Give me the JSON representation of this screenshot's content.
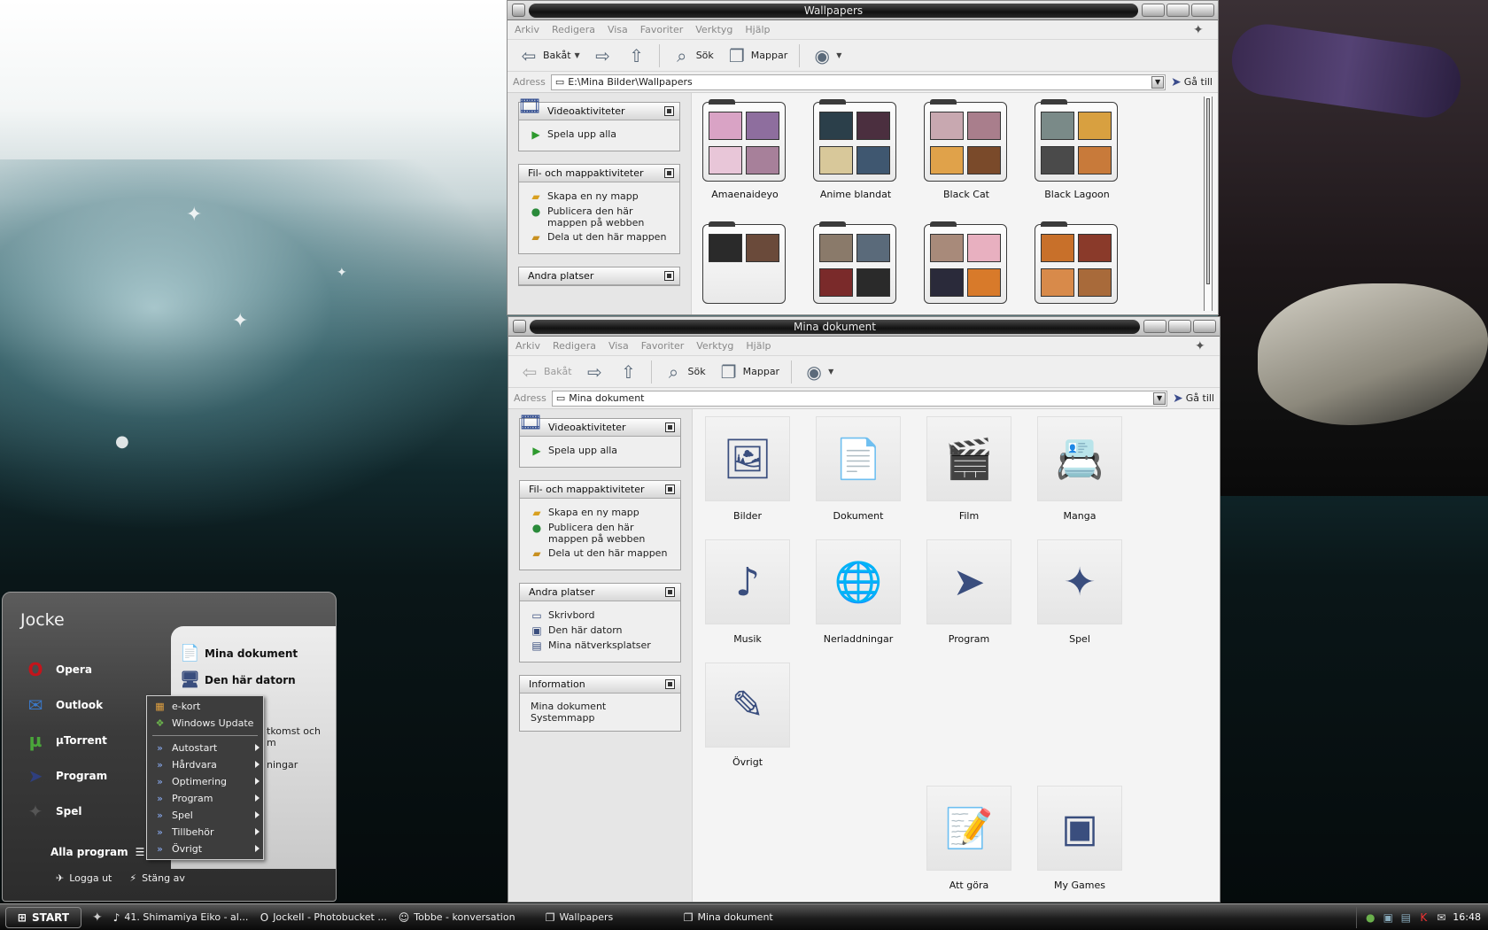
{
  "colors": {
    "accent": "#3a4e7e",
    "titlebar_dark": "#121212",
    "taskbar": "#1d1d1d",
    "startmenu": "#3b3b3b"
  },
  "window_wallpapers": {
    "title": "Wallpapers",
    "menu": [
      "Arkiv",
      "Redigera",
      "Visa",
      "Favoriter",
      "Verktyg",
      "Hjälp"
    ],
    "toolbar": {
      "back": "Bakåt",
      "search": "Sök",
      "folders": "Mappar"
    },
    "address_label": "Adress",
    "address_value": "E:\\Mina Bilder\\Wallpapers",
    "goto": "Gå till",
    "taskpane": {
      "video": {
        "title": "Videoaktiviteter",
        "items": [
          "Spela upp alla"
        ]
      },
      "file": {
        "title": "Fil- och mappaktiviteter",
        "items": [
          "Skapa en ny mapp",
          "Publicera den här mappen på webben",
          "Dela ut den här mappen"
        ]
      },
      "other": {
        "title": "Andra platser"
      }
    },
    "folders": [
      {
        "label": "Amaenaideyo",
        "colors": [
          "#d9a3c5",
          "#8e6e9e",
          "#e8c6d8",
          "#a7809a"
        ]
      },
      {
        "label": "Anime blandat",
        "colors": [
          "#2b3f4a",
          "#4b2f3f",
          "#d8c89a",
          "#3f5770"
        ]
      },
      {
        "label": "Black Cat",
        "colors": [
          "#c8a8b0",
          "#a97e8c",
          "#e0a24a",
          "#7a4a2a"
        ]
      },
      {
        "label": "Black Lagoon",
        "colors": [
          "#7a8a88",
          "#d8a040",
          "#4a4a4a",
          "#c87a3a"
        ]
      },
      {
        "label": "",
        "colors": [
          "#2a2a2a",
          "#6a4a3a"
        ]
      },
      {
        "label": "",
        "colors": [
          "#8a7a6a",
          "#5a6a7a",
          "#7a2a2a",
          "#2a2a2a"
        ]
      },
      {
        "label": "",
        "colors": [
          "#a88a7a",
          "#e8b0c0",
          "#2a2a3a",
          "#d87a2a"
        ]
      },
      {
        "label": "",
        "colors": [
          "#c8702a",
          "#8a3a2a",
          "#d88a4a",
          "#a86a3a"
        ]
      }
    ]
  },
  "window_docs": {
    "title": "Mina dokument",
    "menu": [
      "Arkiv",
      "Redigera",
      "Visa",
      "Favoriter",
      "Verktyg",
      "Hjälp"
    ],
    "toolbar": {
      "back": "Bakåt",
      "search": "Sök",
      "folders": "Mappar"
    },
    "address_label": "Adress",
    "address_value": "Mina dokument",
    "goto": "Gå till",
    "taskpane": {
      "video": {
        "title": "Videoaktiviteter",
        "items": [
          "Spela upp alla"
        ]
      },
      "file": {
        "title": "Fil- och mappaktiviteter",
        "items": [
          "Skapa en ny mapp",
          "Publicera den här mappen på webben",
          "Dela ut den här mappen"
        ]
      },
      "other": {
        "title": "Andra platser",
        "items": [
          "Skrivbord",
          "Den här datorn",
          "Mina nätverksplatser"
        ]
      },
      "info": {
        "title": "Information",
        "line1": "Mina dokument",
        "line2": "Systemmapp"
      }
    },
    "icons": [
      {
        "label": "Bilder",
        "icon": "pictures-folder-icon",
        "glyph": "🖼"
      },
      {
        "label": "Dokument",
        "icon": "documents-folder-icon",
        "glyph": "📄"
      },
      {
        "label": "Film",
        "icon": "clapperboard-icon",
        "glyph": "🎬"
      },
      {
        "label": "Manga",
        "icon": "id-card-book-icon",
        "glyph": "📇"
      },
      {
        "label": "Musik",
        "icon": "music-folder-icon",
        "glyph": "♪"
      },
      {
        "label": "Nerladdningar",
        "icon": "globe-icon",
        "glyph": "🌐"
      },
      {
        "label": "Program",
        "icon": "arrow-icon",
        "glyph": "➤"
      },
      {
        "label": "Spel",
        "icon": "shuriken-icon",
        "glyph": "✦"
      },
      {
        "label": "Övrigt",
        "icon": "pen-folder-icon",
        "glyph": "✎"
      },
      {
        "label": "Att göra",
        "icon": "notepad-icon",
        "glyph": "📝"
      },
      {
        "label": "My Games",
        "icon": "games-folder-icon",
        "glyph": "▣"
      }
    ]
  },
  "startmenu": {
    "user": "Jocke",
    "left_items": [
      {
        "label": "Opera",
        "icon": "opera-icon",
        "glyph": "O",
        "color": "#c4141b"
      },
      {
        "label": "Outlook",
        "icon": "outlook-icon",
        "glyph": "✉",
        "color": "#3a78c8"
      },
      {
        "label": "µTorrent",
        "icon": "utorrent-icon",
        "glyph": "µ",
        "color": "#4aa53a"
      },
      {
        "label": "Program",
        "icon": "program-arrow-icon",
        "glyph": "➤",
        "color": "#2f3f7e"
      },
      {
        "label": "Spel",
        "icon": "spel-shuriken-icon",
        "glyph": "✦",
        "color": "#555555"
      }
    ],
    "all_programs": "Alla program",
    "right_items": [
      "Mina dokument",
      "Den här datorn"
    ],
    "right_partial": [
      "tkomst och",
      "m",
      "ningar"
    ],
    "logout": "Logga ut",
    "shutdown": "Stäng av"
  },
  "submenu": {
    "top": [
      "e-kort",
      "Windows Update"
    ],
    "items": [
      "Autostart",
      "Hårdvara",
      "Optimering",
      "Program",
      "Spel",
      "Tillbehör",
      "Övrigt"
    ]
  },
  "taskbar": {
    "start": "START",
    "tasks": [
      "41. Shimamiya Eiko - al...",
      "JockeII - Photobucket ...",
      "Tobbe - konversation",
      "Wallpapers",
      "Mina dokument"
    ],
    "clock": "16:48"
  }
}
